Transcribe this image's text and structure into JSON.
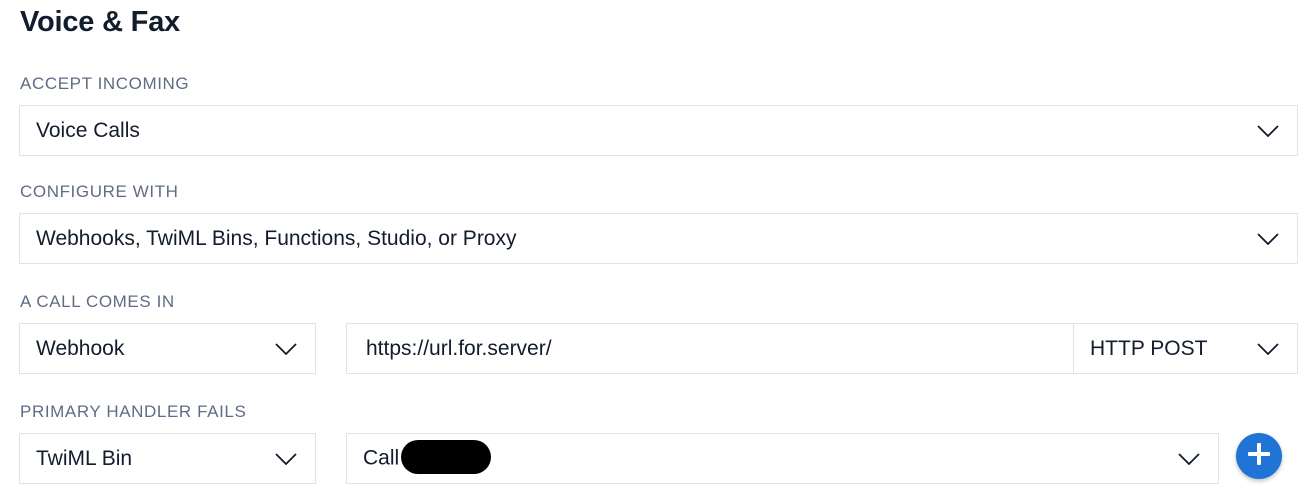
{
  "section": {
    "title": "Voice & Fax"
  },
  "accept_incoming": {
    "label": "ACCEPT INCOMING",
    "value": "Voice Calls"
  },
  "configure_with": {
    "label": "CONFIGURE WITH",
    "value": "Webhooks, TwiML Bins, Functions, Studio, or Proxy"
  },
  "call_comes_in": {
    "label": "A CALL COMES IN",
    "type": "Webhook",
    "url": "https://url.for.server/",
    "method": "HTTP POST"
  },
  "primary_handler_fails": {
    "label": "PRIMARY HANDLER FAILS",
    "type": "TwiML Bin",
    "bin_value": "Call"
  },
  "icons": {
    "chevron": "chevron-down-icon",
    "add": "plus-icon"
  },
  "colors": {
    "accent": "#1f74d6",
    "border": "#e1e3ea",
    "label": "#606b85"
  }
}
